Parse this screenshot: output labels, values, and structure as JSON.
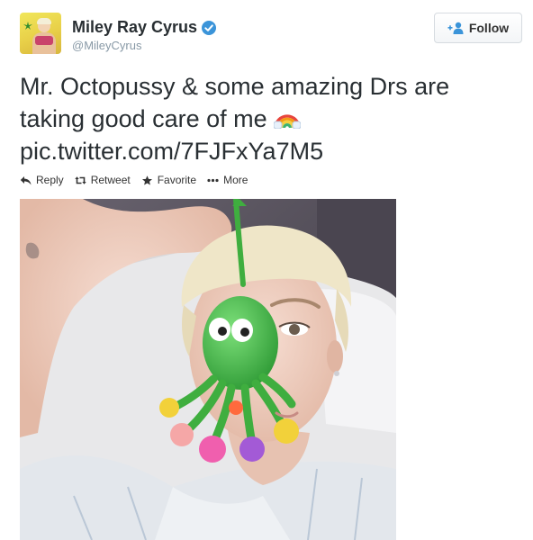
{
  "author": {
    "name": "Miley Ray Cyrus",
    "handle": "@MileyCyrus",
    "verified": true,
    "verified_color": "#3b94d9"
  },
  "follow_button": {
    "label": "Follow",
    "icon": "add-user-icon"
  },
  "tweet": {
    "line1": "Mr. Octopussy & some amazing Drs are",
    "line2": "taking good care of me",
    "emoji": "rainbow-emoji",
    "link": "pic.twitter.com/7FJFxYa7M5"
  },
  "actions": [
    {
      "label": "Reply",
      "icon": "reply-icon"
    },
    {
      "label": "Retweet",
      "icon": "retweet-icon"
    },
    {
      "label": "Favorite",
      "icon": "star-icon"
    },
    {
      "label": "More",
      "icon": "more-dots-icon"
    }
  ],
  "media": {
    "type": "photo",
    "description_icon": "photo-icon"
  }
}
